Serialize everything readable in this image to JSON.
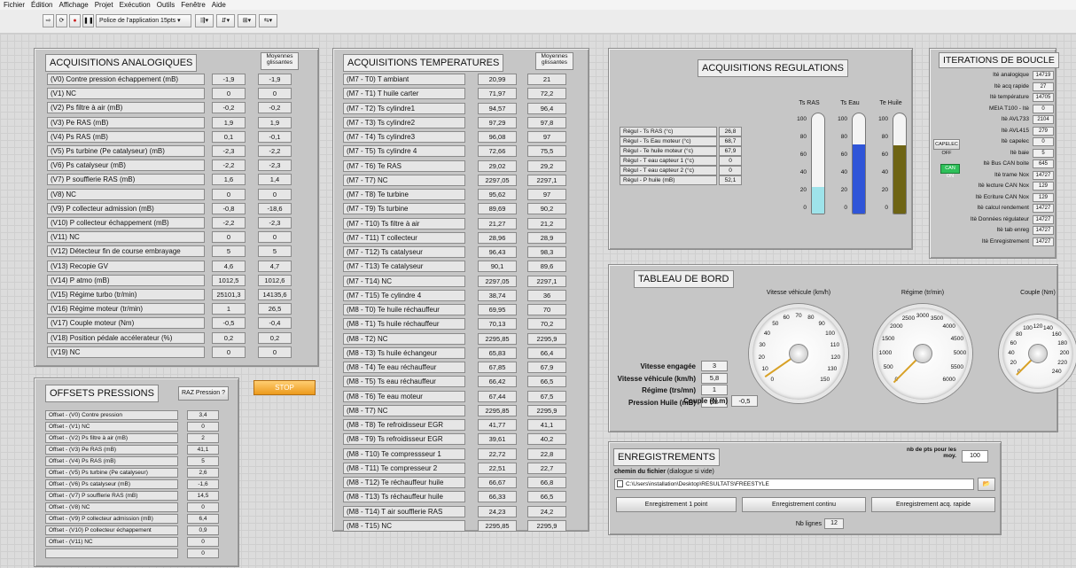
{
  "menu": [
    "Fichier",
    "Édition",
    "Affichage",
    "Projet",
    "Exécution",
    "Outils",
    "Fenêtre",
    "Aide"
  ],
  "toolbar": {
    "font": "Police de l'application 15pts"
  },
  "analog": {
    "title": "ACQUISITIONS ANALOGIQUES",
    "col": "Moyennes glissantes",
    "rows": [
      [
        "(V0) Contre pression échappement (mB)",
        "-1,9",
        "-1,9"
      ],
      [
        "(V1) NC",
        "0",
        "0"
      ],
      [
        "(V2) Ps filtre à air (mB)",
        "-0,2",
        "-0,2"
      ],
      [
        "(V3) Pe RAS (mB)",
        "1,9",
        "1,9"
      ],
      [
        "(V4) Ps RAS (mB)",
        "0,1",
        "-0,1"
      ],
      [
        "(V5) Ps turbine (Pe catalyseur) (mB)",
        "-2,3",
        "-2,2"
      ],
      [
        "(V6) Ps catalyseur (mB)",
        "-2,2",
        "-2,3"
      ],
      [
        "(V7) P soufflerie RAS (mB)",
        "1,6",
        "1,4"
      ],
      [
        "(V8) NC",
        "0",
        "0"
      ],
      [
        "(V9) P collecteur admission (mB)",
        "-0,8",
        "-18,6"
      ],
      [
        "(V10) P collecteur échappement (mB)",
        "-2,2",
        "-2,3"
      ],
      [
        "(V11) NC",
        "0",
        "0"
      ],
      [
        "(V12) Détecteur fin de course embrayage",
        "5",
        "5"
      ],
      [
        "(V13) Recopie GV",
        "4,6",
        "4,7"
      ],
      [
        "(V14) P atmo (mB)",
        "1012,5",
        "1012,6"
      ],
      [
        "(V15) Régime turbo (tr/min)",
        "25101,3",
        "14135,6"
      ],
      [
        "(V16) Régime moteur (tr/min)",
        "1",
        "26,5"
      ],
      [
        "(V17) Couple moteur (Nm)",
        "-0,5",
        "-0,4"
      ],
      [
        "(V18) Position pédale accélerateur (%)",
        "0,2",
        "0,2"
      ],
      [
        "(V19) NC",
        "0",
        "0"
      ]
    ]
  },
  "temps": {
    "title": "ACQUISITIONS TEMPERATURES",
    "col": "Moyennes glissantes",
    "rows": [
      [
        "(M7 - T0) T ambiant",
        "20,99",
        "21"
      ],
      [
        "(M7 - T1) T huile carter",
        "71,97",
        "72,2"
      ],
      [
        "(M7 - T2) Ts cylindre1",
        "94,57",
        "96,4"
      ],
      [
        "(M7 - T3) Ts cylindre2",
        "97,29",
        "97,8"
      ],
      [
        "(M7 - T4) Ts cylindre3",
        "96,08",
        "97"
      ],
      [
        "(M7 - T5) Ts cylindre 4",
        "72,66",
        "75,5"
      ],
      [
        "(M7 - T6) Te RAS",
        "29,02",
        "29,2"
      ],
      [
        "(M7 - T7) NC",
        "2297,05",
        "2297,1"
      ],
      [
        "(M7 - T8) Te turbine",
        "95,62",
        "97"
      ],
      [
        "(M7 - T9) Ts turbine",
        "89,69",
        "90,2"
      ],
      [
        "(M7 - T10) Ts filtre à air",
        "21,27",
        "21,2"
      ],
      [
        "(M7 - T11) T collecteur",
        "28,96",
        "28,9"
      ],
      [
        "(M7 - T12) Ts catalyseur",
        "96,43",
        "98,3"
      ],
      [
        "(M7 - T13) Te catalyseur",
        "90,1",
        "89,6"
      ],
      [
        "(M7 - T14) NC",
        "2297,05",
        "2297,1"
      ],
      [
        "(M7 - T15) Te cylindre 4",
        "38,74",
        "36"
      ],
      [
        "(M8 - T0) Te huile réchauffeur",
        "69,95",
        "70"
      ],
      [
        "(M8 - T1) Ts huile réchauffeur",
        "70,13",
        "70,2"
      ],
      [
        "(M8 - T2) NC",
        "2295,85",
        "2295,9"
      ],
      [
        "(M8 - T3) Ts huile échangeur",
        "65,83",
        "66,4"
      ],
      [
        "(M8 - T4) Te eau réchauffeur",
        "67,85",
        "67,9"
      ],
      [
        "(M8 - T5) Ts eau réchauffeur",
        "66,42",
        "66,5"
      ],
      [
        "(M8 - T6) Te eau moteur",
        "67,44",
        "67,5"
      ],
      [
        "(M8 - T7) NC",
        "2295,85",
        "2295,9"
      ],
      [
        "(M8 - T8) Te refroidisseur EGR",
        "41,77",
        "41,1"
      ],
      [
        "(M8 - T9) Ts refroidisseur EGR",
        "39,61",
        "40,2"
      ],
      [
        "(M8 - T10) Te compressseur 1",
        "22,72",
        "22,8"
      ],
      [
        "(M8 - T11) Te compresseur 2",
        "22,51",
        "22,7"
      ],
      [
        "(M8 - T12) Te réchauffeur huile",
        "66,67",
        "66,8"
      ],
      [
        "(M8 - T13) Ts réchauffeur huile",
        "66,33",
        "66,5"
      ],
      [
        "(M8 - T14) T air soufflerie RAS",
        "24,23",
        "24,2"
      ],
      [
        "(M8 - T15) NC",
        "2295,85",
        "2295,9"
      ]
    ]
  },
  "offsets": {
    "title": "OFFSETS PRESSIONS",
    "raz": "RAZ Pression ?",
    "rows": [
      [
        "Offset - (V0) Contre pression",
        "3,4"
      ],
      [
        "Offset - (V1) NC",
        "0"
      ],
      [
        "Offset - (V2) Ps filtre à air (mB)",
        "2"
      ],
      [
        "Offset - (V3) Pe RAS (mB)",
        "41,1"
      ],
      [
        "Offset - (V4) Ps RAS (mB)",
        "5"
      ],
      [
        "Offset - (V5) Ps turbine (Pe catalyseur)",
        "2,6"
      ],
      [
        "Offset - (V6) Ps catalyseur (mB)",
        "-1,6"
      ],
      [
        "Offset - (V7) P soufflerie RAS (mB)",
        "14,5"
      ],
      [
        "Offset - (V8) NC",
        "0"
      ],
      [
        "Offset - (V9) P collecteur admission (mB)",
        "6,4"
      ],
      [
        "Offset - (V10) P collecteur échappement",
        "0,9"
      ],
      [
        "Offset - (V11) NC",
        "0"
      ],
      [
        "",
        "0"
      ]
    ]
  },
  "stop": "STOP",
  "reg": {
    "title": "ACQUISITIONS REGULATIONS",
    "rows": [
      [
        "Régul - Ts RAS (°c)",
        "26,8"
      ],
      [
        "Régul - Ts Eau moteur (°c)",
        "68,7"
      ],
      [
        "Régul - Te huile moteur (°c)",
        "67,9"
      ],
      [
        "Régul - T eau capteur 1 (°c)",
        "0"
      ],
      [
        "Régul - T eau capteur 2 (°c)",
        "0"
      ],
      [
        "Régul - P huile (mB)",
        "52,1"
      ]
    ],
    "tanks": [
      {
        "label": "Ts RAS",
        "level": 0.27,
        "color": "#9ee3ea"
      },
      {
        "label": "Ts Eau",
        "level": 0.69,
        "color": "#2f55d8"
      },
      {
        "label": "Te Huile",
        "level": 0.68,
        "color": "#6e6414"
      }
    ],
    "ticks": [
      "100",
      "80",
      "60",
      "40",
      "20",
      "0"
    ]
  },
  "iter": {
    "title": "ITERATIONS DE BOUCLE",
    "capelec": "CAPELEC OFF",
    "can": "CAN ON",
    "rows": [
      [
        "Ité analogique",
        "14719"
      ],
      [
        "Itè acq rapide",
        "27"
      ],
      [
        "Itè température",
        "14705"
      ],
      [
        "MEIA T100 - Itè",
        "0"
      ],
      [
        "Itè AVL733",
        "2104"
      ],
      [
        "Itè AVL415",
        "279"
      ],
      [
        "Itè capelec",
        "0"
      ],
      [
        "Itè baie",
        "5"
      ],
      [
        "Itè Bus CAN boite",
        "645"
      ],
      [
        "Itè trame Nox",
        "14727"
      ],
      [
        "Itè lecture CAN Nox",
        "129"
      ],
      [
        "Itè Ecriture CAN Nox",
        "129"
      ],
      [
        "Itè calcul rendement",
        "14727"
      ],
      [
        "Itè Données régulateur",
        "14727"
      ],
      [
        "Itè tab enreg",
        "14727"
      ],
      [
        "Itè Enregistrement",
        "14727"
      ]
    ]
  },
  "dash": {
    "title": "TABLEAU DE BORD",
    "fields": [
      [
        "Vitesse engagée",
        "3"
      ],
      [
        "Vitesse véhicule (km/h)",
        "5,8"
      ],
      [
        "Régime (trs/mn)",
        "1"
      ],
      [
        "Pression Huile (mB)",
        "52"
      ]
    ],
    "couple": [
      "Couple (N.m)",
      "-0,5"
    ],
    "gauges": [
      {
        "title": "Vitesse véhicule (km/h)",
        "labels": [
          "0",
          "10",
          "20",
          "30",
          "40",
          "50",
          "60",
          "70",
          "80",
          "90",
          "100",
          "110",
          "120",
          "130",
          "150"
        ],
        "value": 0.038
      },
      {
        "title": "Régime (tr/min)",
        "labels": [
          "0",
          "500",
          "1000",
          "1500",
          "2000",
          "2500",
          "3000",
          "3500",
          "4000",
          "4500",
          "5000",
          "5500",
          "6000"
        ],
        "value": 0.0
      },
      {
        "title": "Couple (Nm)",
        "labels": [
          "0",
          "20",
          "40",
          "60",
          "80",
          "100",
          "120",
          "140",
          "160",
          "180",
          "200",
          "220",
          "240"
        ],
        "value": 0.0
      }
    ]
  },
  "enreg": {
    "title": "ENREGISTREMENTS",
    "nbpts_label": "nb de pts pour les moy.",
    "nbpts": "100",
    "path_label": "chemin du fichier",
    "path_hint": "(dialogue si vide)",
    "path": "C:\\Users\\installation\\Desktop\\RESULTATS\\FREESTYLE",
    "b1": "Enregistrement 1 point",
    "b2": "Enregistrement continu",
    "b3": "Enregistrement acq. rapide",
    "nbl_label": "Nb lignes",
    "nbl": "12"
  }
}
